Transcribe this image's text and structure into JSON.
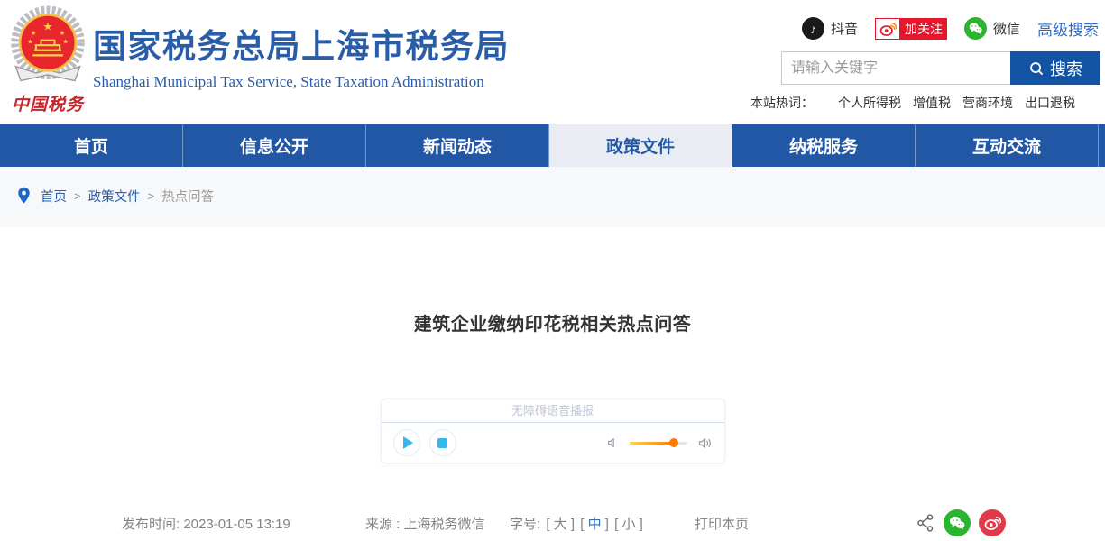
{
  "header": {
    "logo": {
      "caption": "中国税务"
    },
    "site_title": "国家税务总局上海市税务局",
    "site_subtitle": "Shanghai Municipal Tax Service, State Taxation Administration",
    "social": {
      "douyin_label": "抖音",
      "weibo_follow_label": "加关注",
      "wechat_label": "微信",
      "advanced_search_label": "高级搜索"
    },
    "search": {
      "placeholder": "请输入关键字",
      "button_label": "搜索"
    },
    "hot_words": {
      "label": "本站热词：",
      "items": [
        "个人所得税",
        "增值税",
        "营商环境",
        "出口退税"
      ]
    }
  },
  "nav": {
    "items": [
      {
        "label": "首页",
        "active": false
      },
      {
        "label": "信息公开",
        "active": false
      },
      {
        "label": "新闻动态",
        "active": false
      },
      {
        "label": "政策文件",
        "active": true
      },
      {
        "label": "纳税服务",
        "active": false
      },
      {
        "label": "互动交流",
        "active": false
      }
    ]
  },
  "breadcrumb": {
    "separator": ">",
    "items": [
      "首页",
      "政策文件",
      "热点问答"
    ]
  },
  "article": {
    "title": "建筑企业缴纳印花税相关热点问答",
    "audio_player": {
      "header": "无障碍语音播报",
      "volume_percent": 78
    },
    "meta": {
      "publish_label": "发布时间:",
      "publish_value": "2023-01-05 13:19",
      "source_label": "来源 :",
      "source_value": "上海税务微信",
      "fontsize_label": "字号:",
      "bracket_open": "[ ",
      "bracket_close": " ]",
      "sizes": [
        "大",
        "中",
        "小"
      ],
      "active_size": "中",
      "print_label": "打印本页"
    }
  },
  "icons": {
    "douyin": "music-note",
    "weibo": "weibo-eye",
    "wechat": "chat-bubbles",
    "search": "magnifier",
    "breadcrumb_pin": "location-pin",
    "play": "triangle",
    "stop": "square",
    "volume_low": "speaker",
    "volume_high": "speaker-waves",
    "share": "share-nodes"
  },
  "colors": {
    "brand_blue": "#2a5da8",
    "nav_blue": "#2257a5",
    "search_button_blue": "#1353a4",
    "link_blue": "#2e6dc8",
    "active_tab_bg": "#e9edf3",
    "weibo_red": "#e6162d",
    "wechat_green": "#2bb52e",
    "player_accent": "#36b7eb",
    "volume_orange": "#ff7a00"
  }
}
